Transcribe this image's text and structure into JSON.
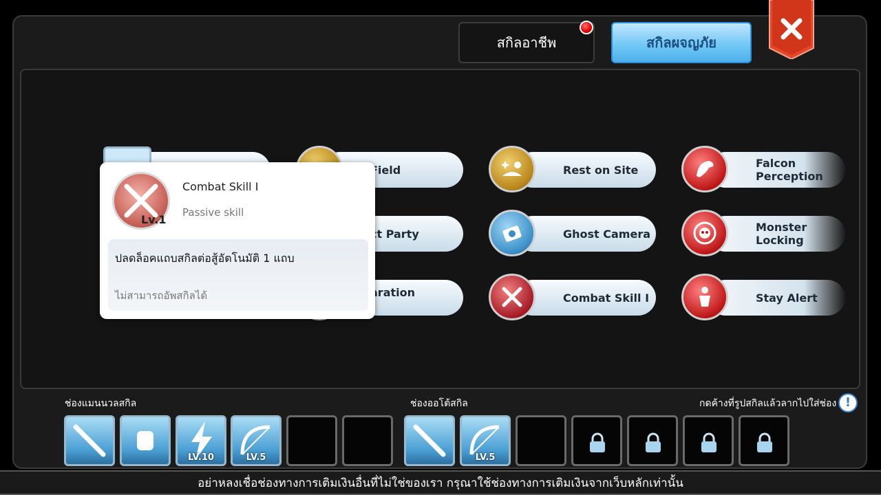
{
  "tabs": [
    {
      "label": "สกิลอาชีพ",
      "active": false,
      "has_notification": true
    },
    {
      "label": "สกิลผจญภัย",
      "active": true
    }
  ],
  "skills": [
    {
      "label": "Field",
      "color": "gold"
    },
    {
      "label": "Rest on Site",
      "color": "gold"
    },
    {
      "label": "Falcon\nPerception",
      "color": "red"
    },
    {
      "label": "ct Party",
      "color": "gold"
    },
    {
      "label": "Ghost Camera",
      "color": "blue"
    },
    {
      "label": "Monster\nLocking",
      "color": "red"
    },
    {
      "label": "aration",
      "color": "gold"
    },
    {
      "label": "Combat Skill I",
      "color": "darkred"
    },
    {
      "label": "Stay Alert",
      "color": "red"
    }
  ],
  "tooltip": {
    "name": "Combat Skill I",
    "level": "Lv.1",
    "type": "Passive skill",
    "description": "ปลดล็อคแถบสกิลต่อสู้อัตโนมัติ 1 แถบ",
    "note": "ไม่สามารถอัพสกิลได้"
  },
  "manual_bar": {
    "label": "ช่องแมนนวลสกิล",
    "slots": [
      {
        "icon": "sword-burst-icon",
        "level": ""
      },
      {
        "icon": "fist-icon",
        "level": ""
      },
      {
        "icon": "lightning-icon",
        "level": "LV.10"
      },
      {
        "icon": "bow-icon",
        "level": "LV.5"
      },
      {
        "icon": "",
        "level": ""
      },
      {
        "icon": "",
        "level": ""
      }
    ]
  },
  "auto_bar": {
    "label": "ช่องออโต้สกิล",
    "slots": [
      {
        "icon": "sword-burst-icon",
        "level": "",
        "locked": false
      },
      {
        "icon": "bow-icon",
        "level": "LV.5",
        "locked": false
      },
      {
        "icon": "",
        "level": "",
        "locked": false
      },
      {
        "icon": "lock-icon",
        "level": "",
        "locked": true
      },
      {
        "icon": "lock-icon",
        "level": "",
        "locked": true
      },
      {
        "icon": "lock-icon",
        "level": "",
        "locked": true
      },
      {
        "icon": "lock-icon",
        "level": "",
        "locked": true
      }
    ]
  },
  "hint": "กดค้างที่รูปสกิลแล้วลากไปใส่ช่อง",
  "footer": "อย่าหลงเชื่อช่องทางการเติมเงินอื่นที่ไม่ใช่ของเรา กรุณาใช้ช่องทางการเติมเงินจากเว็บหลักเท่านั้น"
}
